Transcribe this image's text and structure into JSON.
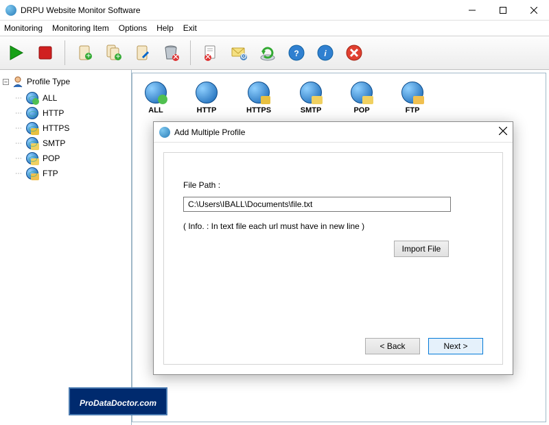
{
  "window": {
    "title": "DRPU Website Monitor Software"
  },
  "menu": {
    "items": [
      "Monitoring",
      "Monitoring Item",
      "Options",
      "Help",
      "Exit"
    ]
  },
  "sidebar": {
    "root": "Profile Type",
    "items": [
      {
        "label": "ALL"
      },
      {
        "label": "HTTP"
      },
      {
        "label": "HTTPS"
      },
      {
        "label": "SMTP"
      },
      {
        "label": "POP"
      },
      {
        "label": "FTP"
      }
    ]
  },
  "profiles": {
    "items": [
      {
        "label": "ALL"
      },
      {
        "label": "HTTP"
      },
      {
        "label": "HTTPS"
      },
      {
        "label": "SMTP"
      },
      {
        "label": "POP"
      },
      {
        "label": "FTP"
      }
    ]
  },
  "dialog": {
    "title": "Add Multiple Profile",
    "file_path_label": "File Path :",
    "file_path_value": "C:\\Users\\IBALL\\Documents\\file.txt",
    "info": "( Info. : In text file each url must have in new line )",
    "import_btn": "Import File",
    "back_btn": "< Back",
    "next_btn": "Next >"
  },
  "watermark": "ProDataDoctor.com"
}
